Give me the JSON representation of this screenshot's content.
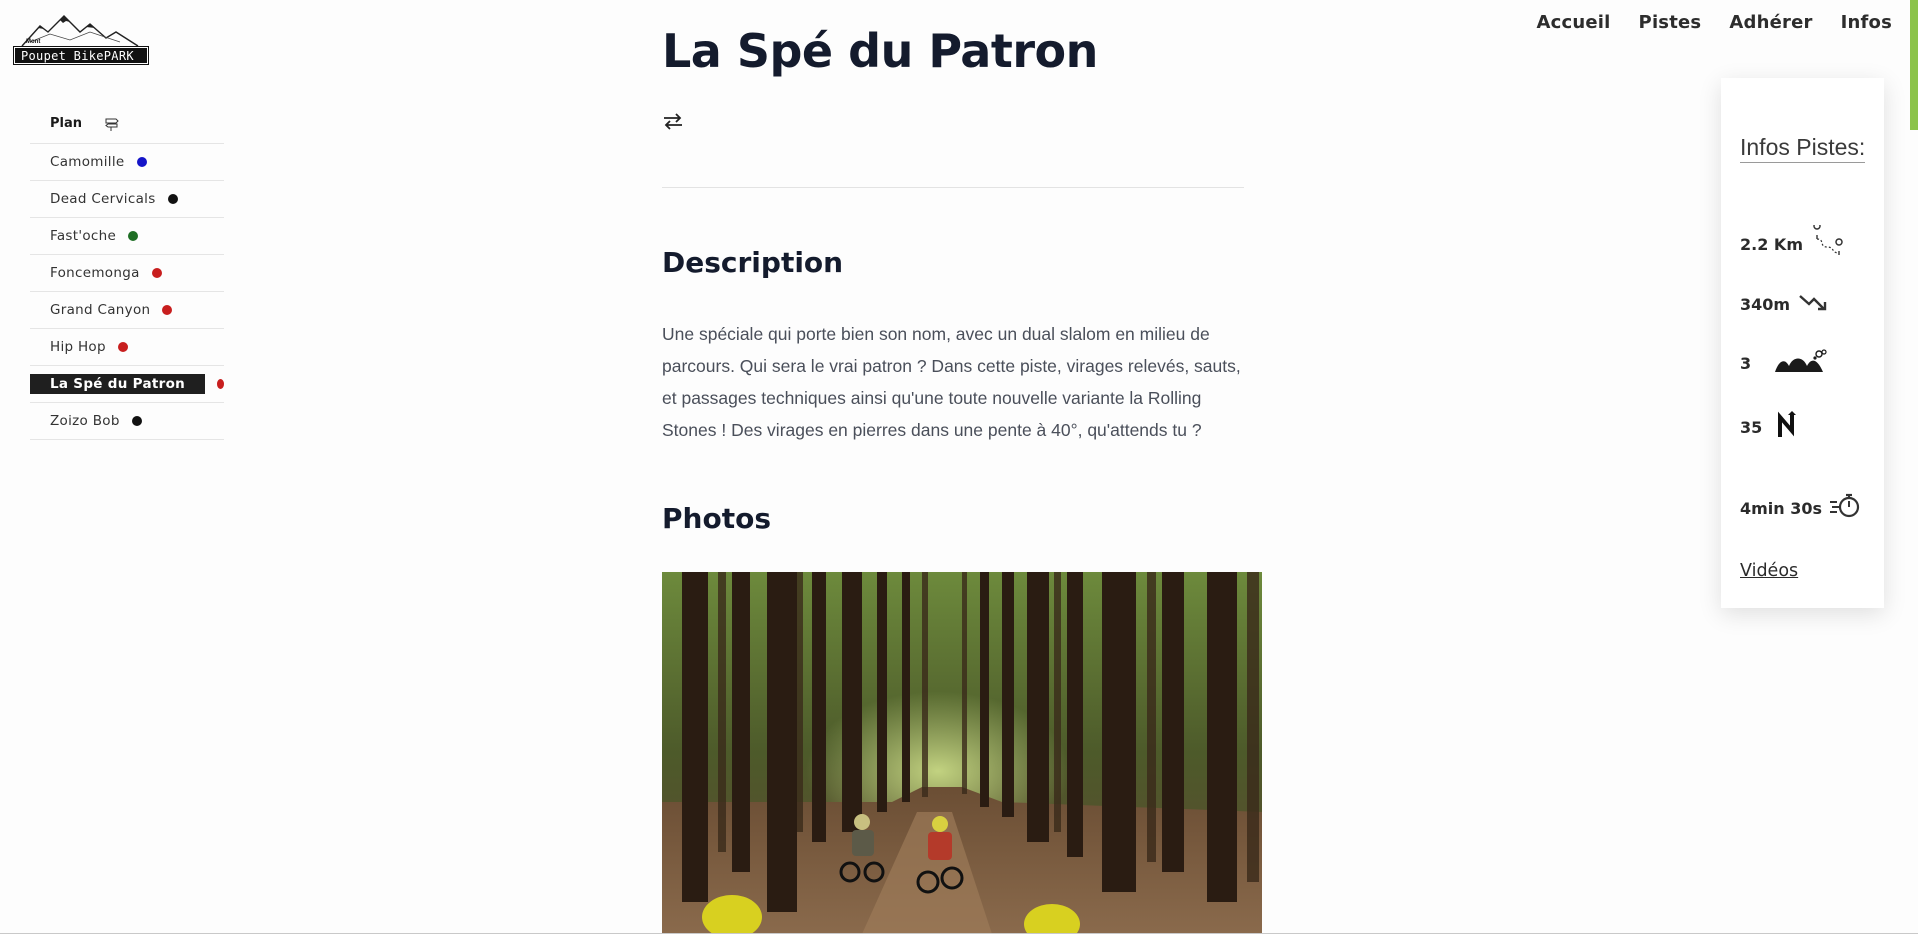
{
  "logo": {
    "top_text": "Mont",
    "name": "Poupet BikePARK"
  },
  "nav": {
    "items": [
      "Accueil",
      "Pistes",
      "Adhérer",
      "Infos"
    ]
  },
  "sidebar": {
    "plan_label": "Plan",
    "items": [
      {
        "label": "Camomille",
        "color": "#1414c8"
      },
      {
        "label": "Dead Cervicals",
        "color": "#111111"
      },
      {
        "label": "Fast'oche",
        "color": "#1e6e24"
      },
      {
        "label": "Foncemonga",
        "color": "#c81e1e"
      },
      {
        "label": "Grand Canyon",
        "color": "#c81e1e"
      },
      {
        "label": "Hip Hop",
        "color": "#c81e1e"
      },
      {
        "label": "La Spé du Patron",
        "color": "#c81e1e",
        "active": true
      },
      {
        "label": "Zoizo Bob",
        "color": "#111111"
      }
    ]
  },
  "main": {
    "title": "La Spé du Patron",
    "description_heading": "Description",
    "description": "Une spéciale qui porte bien son nom, avec un dual slalom en milieu de parcours. Qui sera le vrai patron ? Dans cette piste, virages relevés, sauts, et passages techniques ainsi qu'une toute nouvelle variante la Rolling Stones ! Des virages en pierres dans une pente à 40°, qu'attends tu ?",
    "photos_heading": "Photos"
  },
  "info": {
    "title": "Infos Pistes:",
    "distance": "2.2 Km",
    "descent": "340m",
    "jumps": "3",
    "turns": "35",
    "time": "4min 30s",
    "videos_link": "Vidéos"
  },
  "colors": {
    "accent": "#8bc34a",
    "heading": "#141b2d"
  }
}
